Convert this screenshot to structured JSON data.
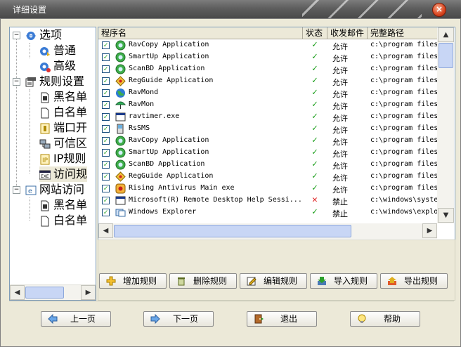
{
  "window": {
    "title": "详细设置",
    "close_glyph": "×"
  },
  "tree": {
    "root1": "选项",
    "general": "普通",
    "advanced": "高级",
    "root2": "规则设置",
    "blacklist": "黑名单",
    "whitelist": "白名单",
    "ports": "端口开",
    "trusted": "可信区",
    "ip_rules": "IP规则",
    "access_rules": "访问规",
    "root3": "网站访问",
    "web_blacklist": "黑名单",
    "web_whitelist": "白名单"
  },
  "table": {
    "headers": [
      "程序名",
      "状态",
      "收发邮件",
      "完整路径"
    ],
    "rows": [
      {
        "name": "RavCopy Application",
        "status": "allow",
        "mail": "允许",
        "path": "c:\\program files",
        "icon": "green-globe-icon"
      },
      {
        "name": "SmartUp  Application",
        "status": "allow",
        "mail": "允许",
        "path": "c:\\program files",
        "icon": "green-globe-icon"
      },
      {
        "name": "ScanBD Application",
        "status": "allow",
        "mail": "允许",
        "path": "c:\\program files",
        "icon": "green-globe-icon"
      },
      {
        "name": "RegGuide Application",
        "status": "allow",
        "mail": "允许",
        "path": "c:\\program files",
        "icon": "diamond-icon"
      },
      {
        "name": "RavMond",
        "status": "allow",
        "mail": "允许",
        "path": "c:\\program files",
        "icon": "earth-icon"
      },
      {
        "name": "RavMon",
        "status": "allow",
        "mail": "允许",
        "path": "c:\\program files",
        "icon": "umbrella-icon"
      },
      {
        "name": "ravtimer.exe",
        "status": "allow",
        "mail": "允许",
        "path": "c:\\program files",
        "icon": "window-icon"
      },
      {
        "name": "RsSMS",
        "status": "allow",
        "mail": "允许",
        "path": "c:\\program files",
        "icon": "phone-icon"
      },
      {
        "name": "RavCopy Application",
        "status": "allow",
        "mail": "允许",
        "path": "c:\\program files",
        "icon": "green-globe-icon"
      },
      {
        "name": "SmartUp  Application",
        "status": "allow",
        "mail": "允许",
        "path": "c:\\program files",
        "icon": "green-globe-icon"
      },
      {
        "name": "ScanBD Application",
        "status": "allow",
        "mail": "允许",
        "path": "c:\\program files",
        "icon": "green-globe-icon"
      },
      {
        "name": "RegGuide Application",
        "status": "allow",
        "mail": "允许",
        "path": "c:\\program files",
        "icon": "diamond-icon"
      },
      {
        "name": "Rising Antivirus Main exe",
        "status": "allow",
        "mail": "允许",
        "path": "c:\\program files",
        "icon": "lion-icon"
      },
      {
        "name": "Microsoft(R) Remote Desktop Help Sessi...",
        "status": "deny",
        "mail": "禁止",
        "path": "c:\\windows\\syste",
        "icon": "window-icon"
      },
      {
        "name": "Windows Explorer",
        "status": "allow",
        "mail": "禁止",
        "path": "c:\\windows\\explo",
        "icon": "explorer-icon"
      }
    ]
  },
  "rule_buttons": {
    "add": "增加规则",
    "delete": "删除规则",
    "edit": "编辑规则",
    "import": "导入规则",
    "export": "导出规则"
  },
  "nav_buttons": {
    "prev": "上一页",
    "next": "下一页",
    "exit": "退出",
    "help": "帮助"
  },
  "colors": {
    "allow": "#21a121",
    "deny": "#e02020",
    "title_bg": "#5e5e5e",
    "dialog_bg": "#ece9d8"
  }
}
